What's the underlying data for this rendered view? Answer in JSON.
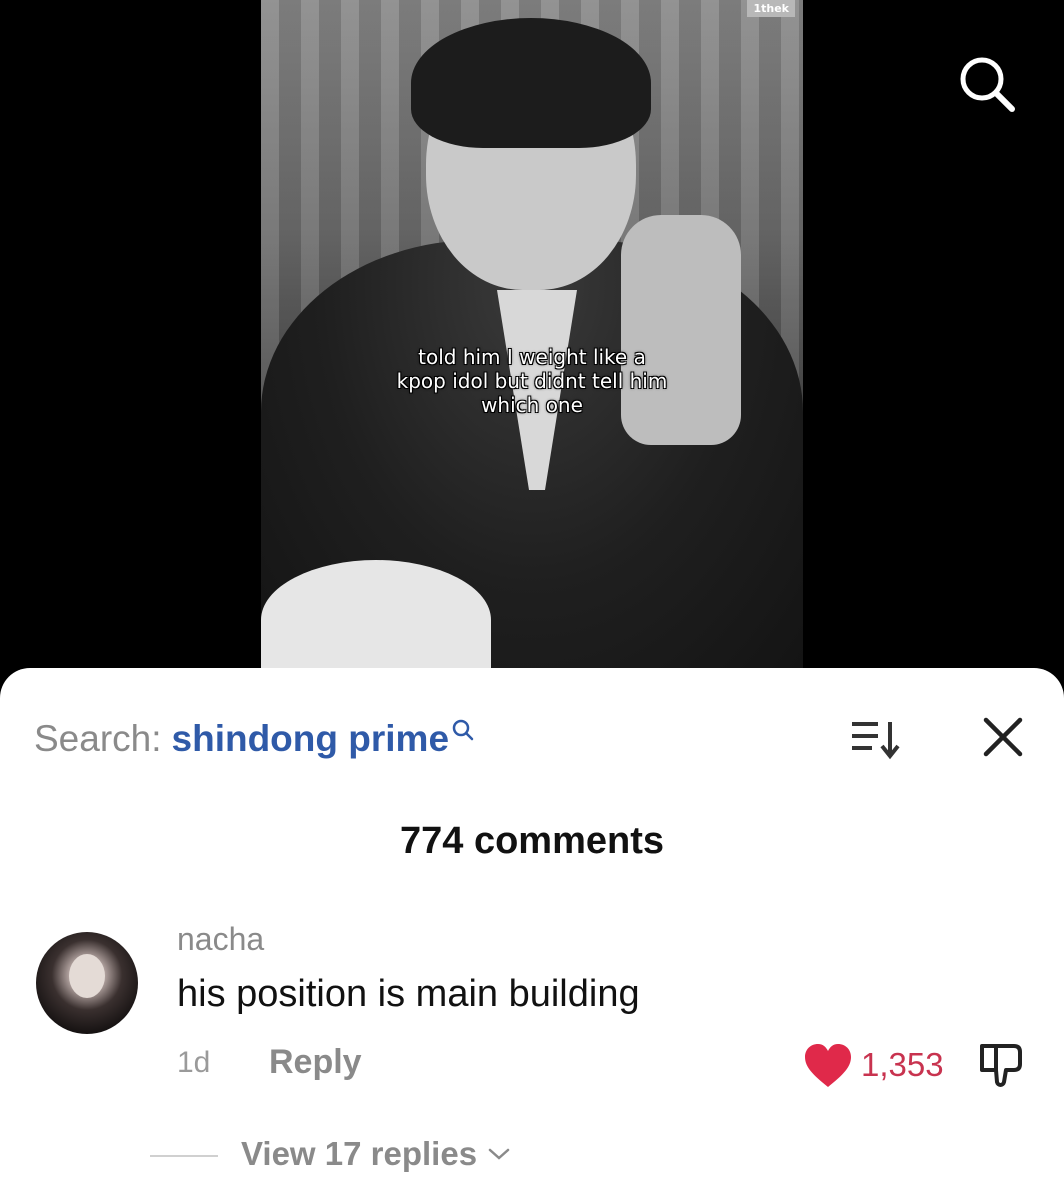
{
  "video": {
    "watermark": "1thek",
    "caption_lines": [
      "told him I weight like a",
      "kpop idol but didnt tell him",
      "which one"
    ],
    "top_right_icon": "search-icon"
  },
  "sheet": {
    "search_prefix": "Search:",
    "search_query": "shindong prime",
    "search_query_color": "#2f5aa8",
    "icons": [
      "search-icon",
      "sort-icon",
      "close-icon"
    ],
    "comments_count_label": "774 comments"
  },
  "comment": {
    "username": "nacha",
    "text": "his position is main building",
    "time": "1d",
    "reply_label": "Reply",
    "like_count": "1,353",
    "like_color": "#e0294a",
    "liked": true,
    "view_replies_label": "View 17 replies"
  }
}
